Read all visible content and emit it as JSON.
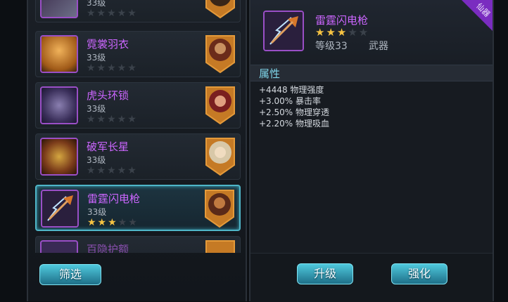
{
  "items": [
    {
      "name": "",
      "level": "33级",
      "stars": 0
    },
    {
      "name": "霓裳羽衣",
      "level": "33级",
      "stars": 0
    },
    {
      "name": "虎头环锁",
      "level": "33级",
      "stars": 0
    },
    {
      "name": "破军长星",
      "level": "33级",
      "stars": 0
    },
    {
      "name": "雷霆闪电枪",
      "level": "33级",
      "stars": 3
    },
    {
      "name": "百隐护额",
      "level": "",
      "stars": 0
    }
  ],
  "filter_label": "筛选",
  "detail": {
    "name": "雷霆闪电枪",
    "stars": 3,
    "level": "等级33",
    "type": "武器",
    "ribbon": "仙器",
    "section_title": "属性",
    "attributes": [
      "+4448 物理强度",
      "+3.00% 暴击率",
      "+2.50% 物理穿透",
      "+2.20% 物理吸血"
    ]
  },
  "buttons": {
    "upgrade": "升级",
    "enhance": "强化"
  },
  "colors": {
    "rarity": "#cc66ff",
    "accent": "#4fb6c8",
    "star": "#f6c343"
  }
}
